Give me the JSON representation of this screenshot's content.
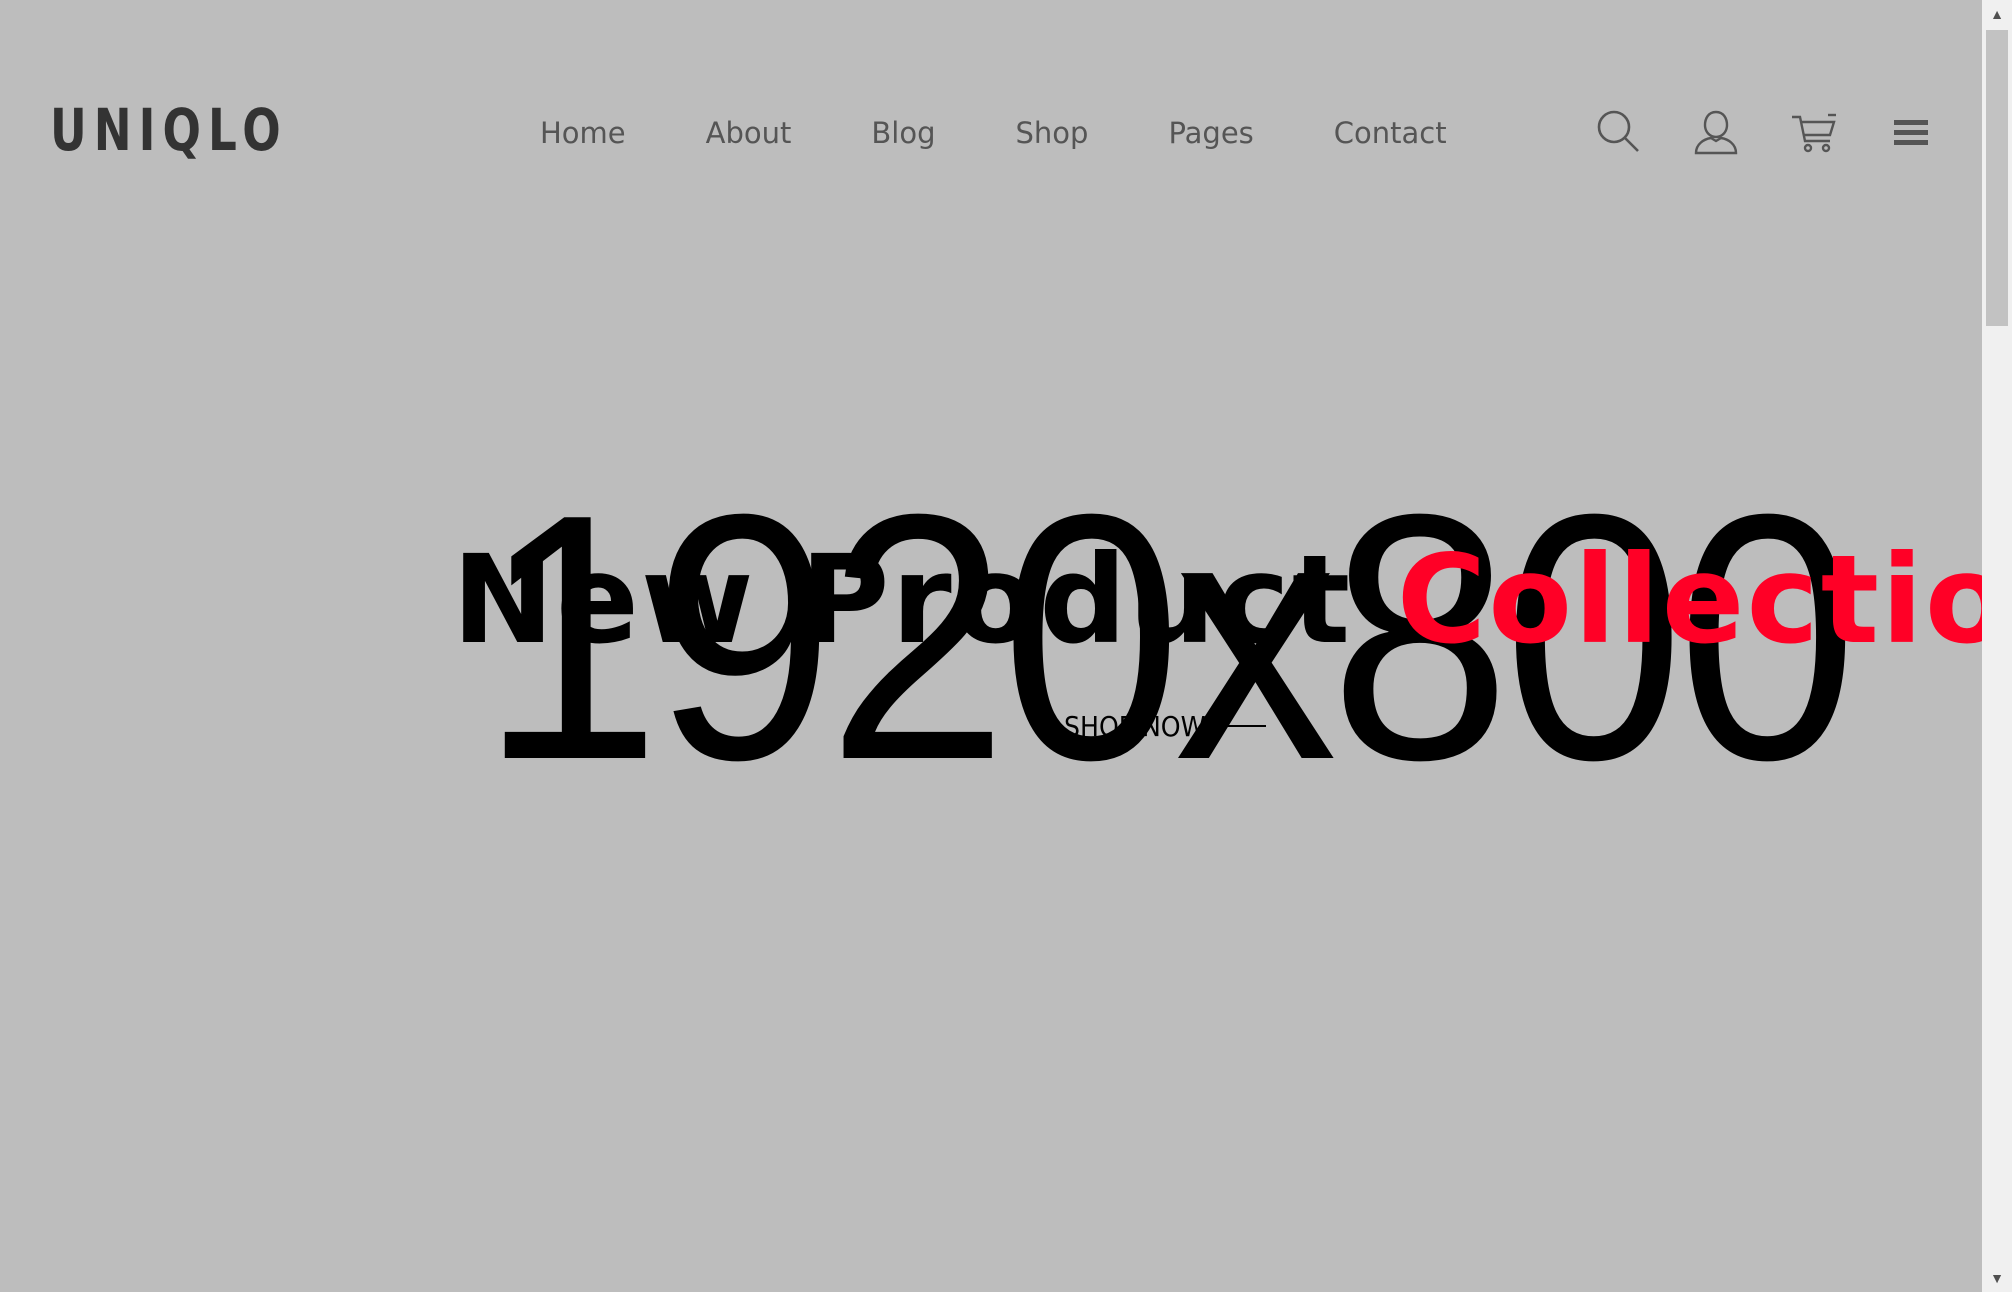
{
  "header": {
    "logo_text": "UNIQLO",
    "nav": [
      {
        "label": "Home"
      },
      {
        "label": "About"
      },
      {
        "label": "Blog"
      },
      {
        "label": "Shop"
      },
      {
        "label": "Pages"
      },
      {
        "label": "Contact"
      }
    ],
    "icons": [
      "search-icon",
      "user-icon",
      "cart-icon",
      "menu-icon"
    ]
  },
  "hero": {
    "placeholder_text": "1920x800",
    "title_part1": "New Product",
    "title_part2": "Collection",
    "cta_label": "SHOP NOW"
  },
  "colors": {
    "background": "#bdbdbd",
    "accent": "#ff0026",
    "nav_text": "#555555",
    "logo": "#333333"
  }
}
